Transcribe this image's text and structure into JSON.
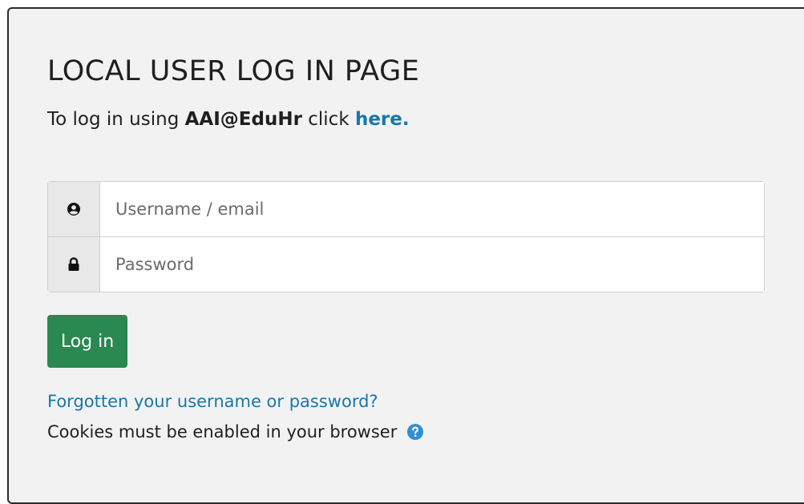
{
  "login": {
    "title": "LOCAL USER LOG IN PAGE",
    "subtitle_prefix": "To log in using ",
    "subtitle_bold": "AAI@EduHr",
    "subtitle_middle": " click ",
    "subtitle_link": "here.",
    "username_placeholder": "Username / email",
    "password_placeholder": "Password",
    "button_label": "Log in",
    "forgot_link": "Forgotten your username or password?",
    "cookies_text": "Cookies must be enabled in your browser"
  },
  "icons": {
    "username": "user-icon",
    "password": "lock-icon",
    "help": "help-icon"
  },
  "colors": {
    "background": "#f2f2f2",
    "link": "#1778a8",
    "button": "#2a8851",
    "help_icon": "#2f8fd1"
  }
}
